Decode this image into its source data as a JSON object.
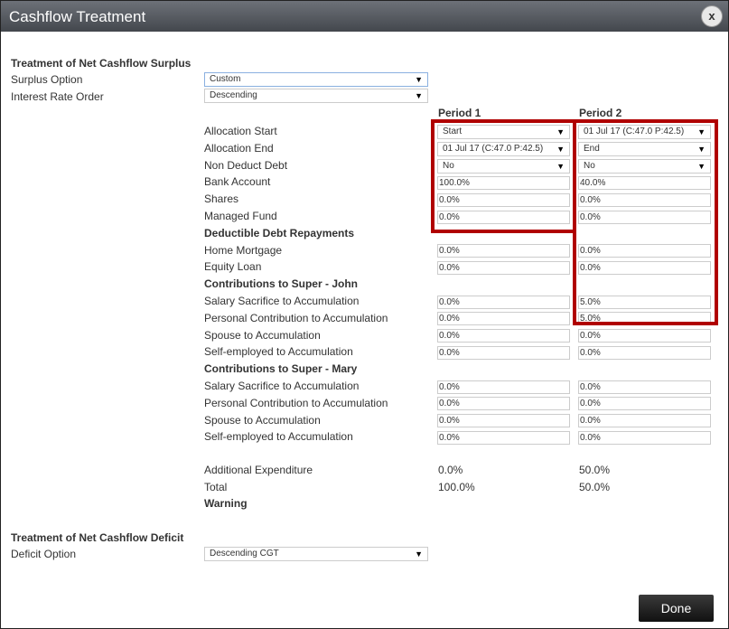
{
  "title": "Cashflow Treatment",
  "close_label": "x",
  "surplus": {
    "heading": "Treatment of Net Cashflow Surplus",
    "surplus_option_label": "Surplus Option",
    "surplus_option_value": "Custom",
    "interest_rate_label": "Interest Rate Order",
    "interest_rate_value": "Descending"
  },
  "periods": [
    "Period 1",
    "Period 2"
  ],
  "rows": [
    {
      "label": "Allocation Start",
      "type": "select",
      "p1": "Start",
      "p2": "01 Jul 17 (C:47.0 P:42.5)"
    },
    {
      "label": "Allocation End",
      "type": "select",
      "p1": "01 Jul 17 (C:47.0 P:42.5)",
      "p2": "End"
    },
    {
      "label": "Non Deduct Debt",
      "type": "select",
      "p1": "No",
      "p2": "No"
    },
    {
      "label": "Bank Account",
      "type": "input",
      "p1": "100.0%",
      "p2": "40.0%"
    },
    {
      "label": "Shares",
      "type": "input",
      "p1": "0.0%",
      "p2": "0.0%"
    },
    {
      "label": "Managed Fund",
      "type": "input",
      "p1": "0.0%",
      "p2": "0.0%"
    },
    {
      "label": "Deductible Debt Repayments",
      "type": "heading"
    },
    {
      "label": "Home Mortgage",
      "type": "input",
      "p1": "0.0%",
      "p2": "0.0%"
    },
    {
      "label": "Equity Loan",
      "type": "input",
      "p1": "0.0%",
      "p2": "0.0%"
    },
    {
      "label": "Contributions to Super - John",
      "type": "heading"
    },
    {
      "label": "Salary Sacrifice to Accumulation",
      "type": "input",
      "p1": "0.0%",
      "p2": "5.0%"
    },
    {
      "label": "Personal Contribution to Accumulation",
      "type": "input",
      "p1": "0.0%",
      "p2": "5.0%"
    },
    {
      "label": "Spouse to Accumulation",
      "type": "input",
      "p1": "0.0%",
      "p2": "0.0%"
    },
    {
      "label": "Self-employed to Accumulation",
      "type": "input",
      "p1": "0.0%",
      "p2": "0.0%"
    },
    {
      "label": "Contributions to Super - Mary",
      "type": "heading"
    },
    {
      "label": "Salary Sacrifice to Accumulation",
      "type": "input",
      "p1": "0.0%",
      "p2": "0.0%"
    },
    {
      "label": "Personal Contribution to Accumulation",
      "type": "input",
      "p1": "0.0%",
      "p2": "0.0%"
    },
    {
      "label": "Spouse to Accumulation",
      "type": "input",
      "p1": "0.0%",
      "p2": "0.0%"
    },
    {
      "label": "Self-employed to Accumulation",
      "type": "input",
      "p1": "0.0%",
      "p2": "0.0%"
    }
  ],
  "summary": [
    {
      "label": "Additional Expenditure",
      "p1": "0.0%",
      "p2": "50.0%"
    },
    {
      "label": "Total",
      "p1": "100.0%",
      "p2": "50.0%"
    }
  ],
  "warning": "Warning",
  "deficit": {
    "heading": "Treatment of Net Cashflow Deficit",
    "option_label": "Deficit Option",
    "option_value": "Descending CGT"
  },
  "done_label": "Done",
  "highlight_color": "#b00000"
}
